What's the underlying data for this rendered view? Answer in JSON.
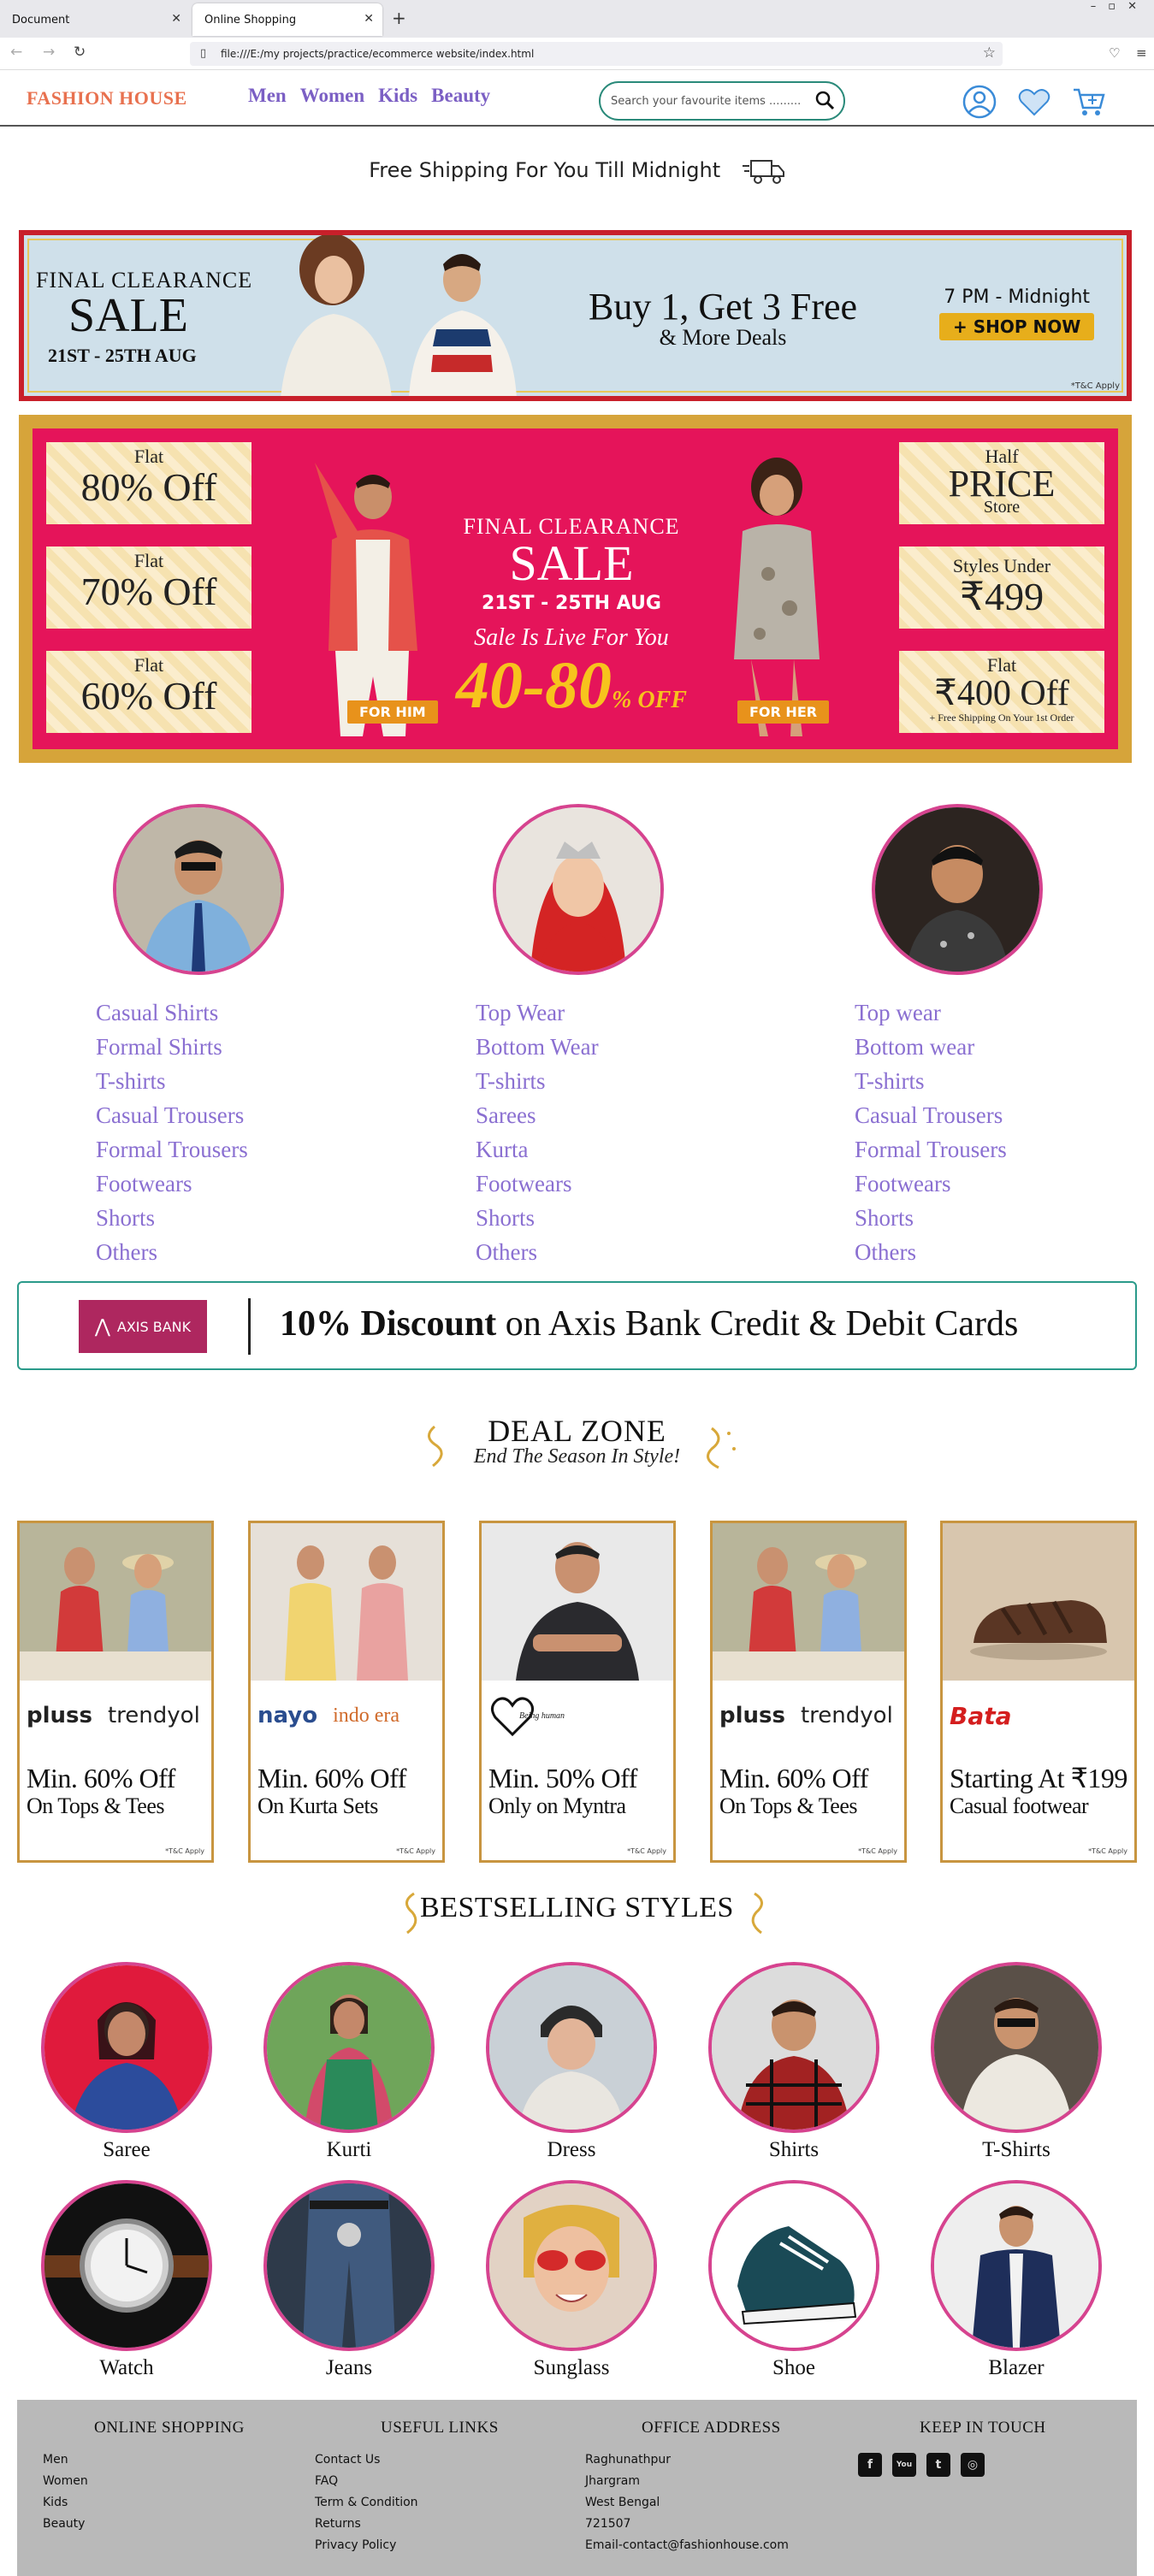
{
  "browser": {
    "tabs": [
      {
        "label": "Document",
        "active": false
      },
      {
        "label": "Online Shopping",
        "active": true
      }
    ],
    "url": "file:///E:/my projects/practice/ecommerce website/index.html"
  },
  "header": {
    "logo": "FASHION HOUSE",
    "nav": [
      "Men",
      "Women",
      "Kids",
      "Beauty"
    ],
    "search_placeholder": "Search your favourite items .........",
    "icons": [
      "user-icon",
      "heart-icon",
      "cart-icon"
    ]
  },
  "shipping_text": "Free Shipping For You Till Midnight",
  "banner1": {
    "line1": "FINAL CLEARANCE",
    "line2": "SALE",
    "dates": "21ST - 25TH AUG",
    "headline": "Buy 1, Get 3 Free",
    "subheadline": "& More Deals",
    "time": "7 PM - Midnight",
    "button": "+ SHOP NOW",
    "tc": "*T&C Apply"
  },
  "banner2": {
    "left_offers": [
      {
        "small": "Flat",
        "big": "80% Off"
      },
      {
        "small": "Flat",
        "big": "70% Off"
      },
      {
        "small": "Flat",
        "big": "60% Off"
      }
    ],
    "right_offers": [
      {
        "small": "Half",
        "big": "PRICE",
        "tiny": "Store"
      },
      {
        "small": "Styles Under",
        "big": "₹499",
        "tiny": ""
      },
      {
        "small": "Flat",
        "big": "₹400 Off",
        "tiny": "+ Free Shipping On Your 1st Order"
      }
    ],
    "title1": "FINAL CLEARANCE",
    "title2": "SALE",
    "dates": "21ST - 25TH AUG",
    "live": "Sale Is Live For You",
    "range": "40-80",
    "range_suffix": "% OFF",
    "for_him": "FOR HIM",
    "for_her": "FOR HER"
  },
  "categories": [
    {
      "name": "men",
      "items": [
        "Casual Shirts",
        "Formal Shirts",
        "T-shirts",
        "Casual Trousers",
        "Formal Trousers",
        "Footwears",
        "Shorts",
        "Others"
      ]
    },
    {
      "name": "women",
      "items": [
        "Top Wear",
        "Bottom Wear",
        "T-shirts",
        "Sarees",
        "Kurta",
        "Footwears",
        "Shorts",
        "Others"
      ]
    },
    {
      "name": "kids",
      "items": [
        "Top wear",
        "Bottom wear",
        "T-shirts",
        "Casual Trousers",
        "Formal Trousers",
        "Footwears",
        "Shorts",
        "Others"
      ]
    }
  ],
  "axis": {
    "logo_text": "AXIS BANK",
    "discount": "10% Discount",
    "rest": " on Axis Bank Credit & Debit Cards"
  },
  "deal_zone": {
    "title": "DEAL ZONE",
    "subtitle": "End The Season In Style!",
    "cards": [
      {
        "brands": [
          "pluss",
          "trendyol"
        ],
        "offer": "Min. 60% Off",
        "sub": "On Tops & Tees",
        "tc": "*T&C Apply"
      },
      {
        "brands": [
          "nayo",
          "indo era"
        ],
        "offer": "Min. 60% Off",
        "sub": "On Kurta Sets",
        "tc": "*T&C Apply"
      },
      {
        "brands": [
          "Being human"
        ],
        "offer": "Min. 50% Off",
        "sub": "Only on Myntra",
        "tc": "*T&C Apply"
      },
      {
        "brands": [
          "pluss",
          "trendyol"
        ],
        "offer": "Min. 60% Off",
        "sub": "On Tops & Tees",
        "tc": "*T&C Apply"
      },
      {
        "brands": [
          "Bata"
        ],
        "offer": "Starting At ₹199",
        "sub": "Casual footwear",
        "tc": "*T&C Apply"
      }
    ]
  },
  "bestselling": {
    "title": "BESTSELLING STYLES",
    "items": [
      "Saree",
      "Kurti",
      "Dress",
      "Shirts",
      "T-Shirts",
      "Watch",
      "Jeans",
      "Sunglass",
      "Shoe",
      "Blazer"
    ]
  },
  "footer": {
    "online_shopping": {
      "title": "ONLINE SHOPPING",
      "links": [
        "Men",
        "Women",
        "Kids",
        "Beauty"
      ]
    },
    "useful_links": {
      "title": "USEFUL LINKS",
      "links": [
        "Contact Us",
        "FAQ",
        "Term & Condition",
        "Returns",
        "Privacy Policy"
      ]
    },
    "office_address": {
      "title": "OFFICE ADDRESS",
      "lines": [
        "Raghunathpur",
        "Jhargram",
        "West Bengal",
        "721507",
        "Email-contact@fashionhouse.com"
      ]
    },
    "keep_in_touch": {
      "title": "KEEP IN TOUCH",
      "social": [
        "facebook-icon",
        "youtube-icon",
        "twitter-icon",
        "instagram-icon"
      ]
    }
  },
  "colors": {
    "logo": "#e8714f",
    "nav": "#7b5fc4",
    "category_link": "#8a6fd1",
    "photo_ring": "#d6438f",
    "teal": "#2a8a7a",
    "banner_pink": "#e5145a",
    "gold": "#d6a43a",
    "footer_bg": "#b9b9b9"
  }
}
